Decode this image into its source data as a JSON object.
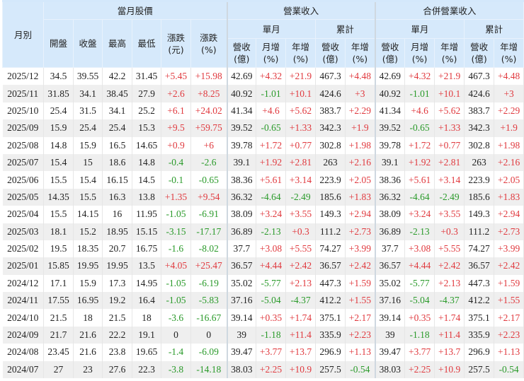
{
  "headers": {
    "month": "月別",
    "stock_group": "當月股價",
    "revenue_group": "營業收入",
    "consolidated_group": "合併營業收入",
    "single_month": "單月",
    "cumulative": "累計",
    "stock_cols": [
      "開盤",
      "收盤",
      "最高",
      "最低",
      "漲跌\n(元)",
      "漲跌\n(%)"
    ],
    "rev_cols": [
      "營收\n(億)",
      "月增\n(%)",
      "年增\n(%)",
      "營收\n(億)",
      "年增\n(%)"
    ]
  },
  "rows": [
    [
      "2025/12",
      "34.5",
      "39.55",
      "42.2",
      "31.45",
      "+5.45",
      "+15.98",
      "42.69",
      "+4.32",
      "+21.9",
      "467.3",
      "+4.48",
      "42.69",
      "+4.32",
      "+21.9",
      "467.3",
      "+4.48"
    ],
    [
      "2025/11",
      "31.85",
      "34.1",
      "38.45",
      "27.9",
      "+2.6",
      "+8.25",
      "40.92",
      "-1.01",
      "+10.1",
      "424.6",
      "+3",
      "40.92",
      "-1.01",
      "+10.1",
      "424.6",
      "+3"
    ],
    [
      "2025/10",
      "25.4",
      "31.5",
      "34.1",
      "25.2",
      "+6.1",
      "+24.02",
      "41.34",
      "+4.6",
      "+5.62",
      "383.7",
      "+2.29",
      "41.34",
      "+4.6",
      "+5.62",
      "383.7",
      "+2.29"
    ],
    [
      "2025/09",
      "15.9",
      "25.4",
      "25.4",
      "15.3",
      "+9.5",
      "+59.75",
      "39.52",
      "-0.65",
      "+1.33",
      "342.3",
      "+1.9",
      "39.52",
      "-0.65",
      "+1.33",
      "342.3",
      "+1.9"
    ],
    [
      "2025/08",
      "14.8",
      "15.9",
      "16.5",
      "14.65",
      "+0.9",
      "+6",
      "39.78",
      "+1.72",
      "+0.77",
      "302.8",
      "+1.98",
      "39.78",
      "+1.72",
      "+0.77",
      "302.8",
      "+1.98"
    ],
    [
      "2025/07",
      "15.4",
      "15",
      "18.6",
      "14.8",
      "-0.4",
      "-2.6",
      "39.1",
      "+1.92",
      "+2.81",
      "263",
      "+2.16",
      "39.1",
      "+1.92",
      "+2.81",
      "263",
      "+2.16"
    ],
    [
      "2025/06",
      "15.5",
      "15.4",
      "16.15",
      "14.5",
      "-0.1",
      "-0.65",
      "38.36",
      "+5.61",
      "+3.14",
      "223.9",
      "+2.05",
      "38.36",
      "+5.61",
      "+3.14",
      "223.9",
      "+2.05"
    ],
    [
      "2025/05",
      "14.35",
      "15.5",
      "16.3",
      "13.8",
      "+1.35",
      "+9.54",
      "36.32",
      "-4.64",
      "-2.49",
      "185.6",
      "+1.83",
      "36.32",
      "-4.64",
      "-2.49",
      "185.6",
      "+1.83"
    ],
    [
      "2025/04",
      "15.5",
      "14.15",
      "16",
      "11.95",
      "-1.05",
      "-6.91",
      "38.09",
      "+3.24",
      "+3.55",
      "149.3",
      "+2.94",
      "38.09",
      "+3.24",
      "+3.55",
      "149.3",
      "+2.94"
    ],
    [
      "2025/03",
      "18.1",
      "15.2",
      "18.95",
      "15.15",
      "-3.15",
      "-17.17",
      "36.89",
      "-2.13",
      "+0.3",
      "111.2",
      "+2.73",
      "36.89",
      "-2.13",
      "+0.3",
      "111.2",
      "+2.73"
    ],
    [
      "2025/02",
      "19.5",
      "18.35",
      "20.7",
      "16.75",
      "-1.6",
      "-8.02",
      "37.7",
      "+3.08",
      "+5.55",
      "74.27",
      "+3.99",
      "37.7",
      "+3.08",
      "+5.55",
      "74.27",
      "+3.99"
    ],
    [
      "2025/01",
      "15.85",
      "19.95",
      "19.95",
      "13.5",
      "+4.05",
      "+25.47",
      "36.57",
      "+4.44",
      "+2.42",
      "36.57",
      "+2.42",
      "36.57",
      "+4.44",
      "+2.42",
      "36.57",
      "+2.42"
    ],
    [
      "2024/12",
      "17.1",
      "15.9",
      "17.3",
      "14.95",
      "-1.05",
      "-6.19",
      "35.02",
      "-5.77",
      "+2.13",
      "447.3",
      "+1.59",
      "35.02",
      "-5.77",
      "+2.13",
      "447.3",
      "+1.59"
    ],
    [
      "2024/11",
      "17.55",
      "16.95",
      "19.2",
      "16.4",
      "-1.05",
      "-5.83",
      "37.16",
      "-5.04",
      "-4.37",
      "412.2",
      "+1.55",
      "37.16",
      "-5.04",
      "-4.37",
      "412.2",
      "+1.55"
    ],
    [
      "2024/10",
      "21.5",
      "18",
      "21.5",
      "18",
      "-3.6",
      "-16.67",
      "39.14",
      "+0.35",
      "+1.74",
      "375.1",
      "+2.17",
      "39.14",
      "+0.35",
      "+1.74",
      "375.1",
      "+2.17"
    ],
    [
      "2024/09",
      "21.7",
      "21.6",
      "22.2",
      "19.1",
      "0",
      "0",
      "39",
      "-1.18",
      "+11.4",
      "335.9",
      "+2.23",
      "39",
      "-1.18",
      "+11.4",
      "335.9",
      "+2.23"
    ],
    [
      "2024/08",
      "23.45",
      "21.6",
      "23.8",
      "19.65",
      "-1.4",
      "-6.09",
      "39.47",
      "+3.77",
      "+13.7",
      "296.9",
      "+1.13",
      "39.47",
      "+3.77",
      "+13.7",
      "296.9",
      "+1.13"
    ],
    [
      "2024/07",
      "27",
      "23",
      "27.6",
      "22.3",
      "-3.8",
      "-14.18",
      "38.03",
      "+2.25",
      "+10.9",
      "257.5",
      "-0.54",
      "38.03",
      "+2.25",
      "+10.9",
      "257.5",
      "-0.54"
    ]
  ]
}
